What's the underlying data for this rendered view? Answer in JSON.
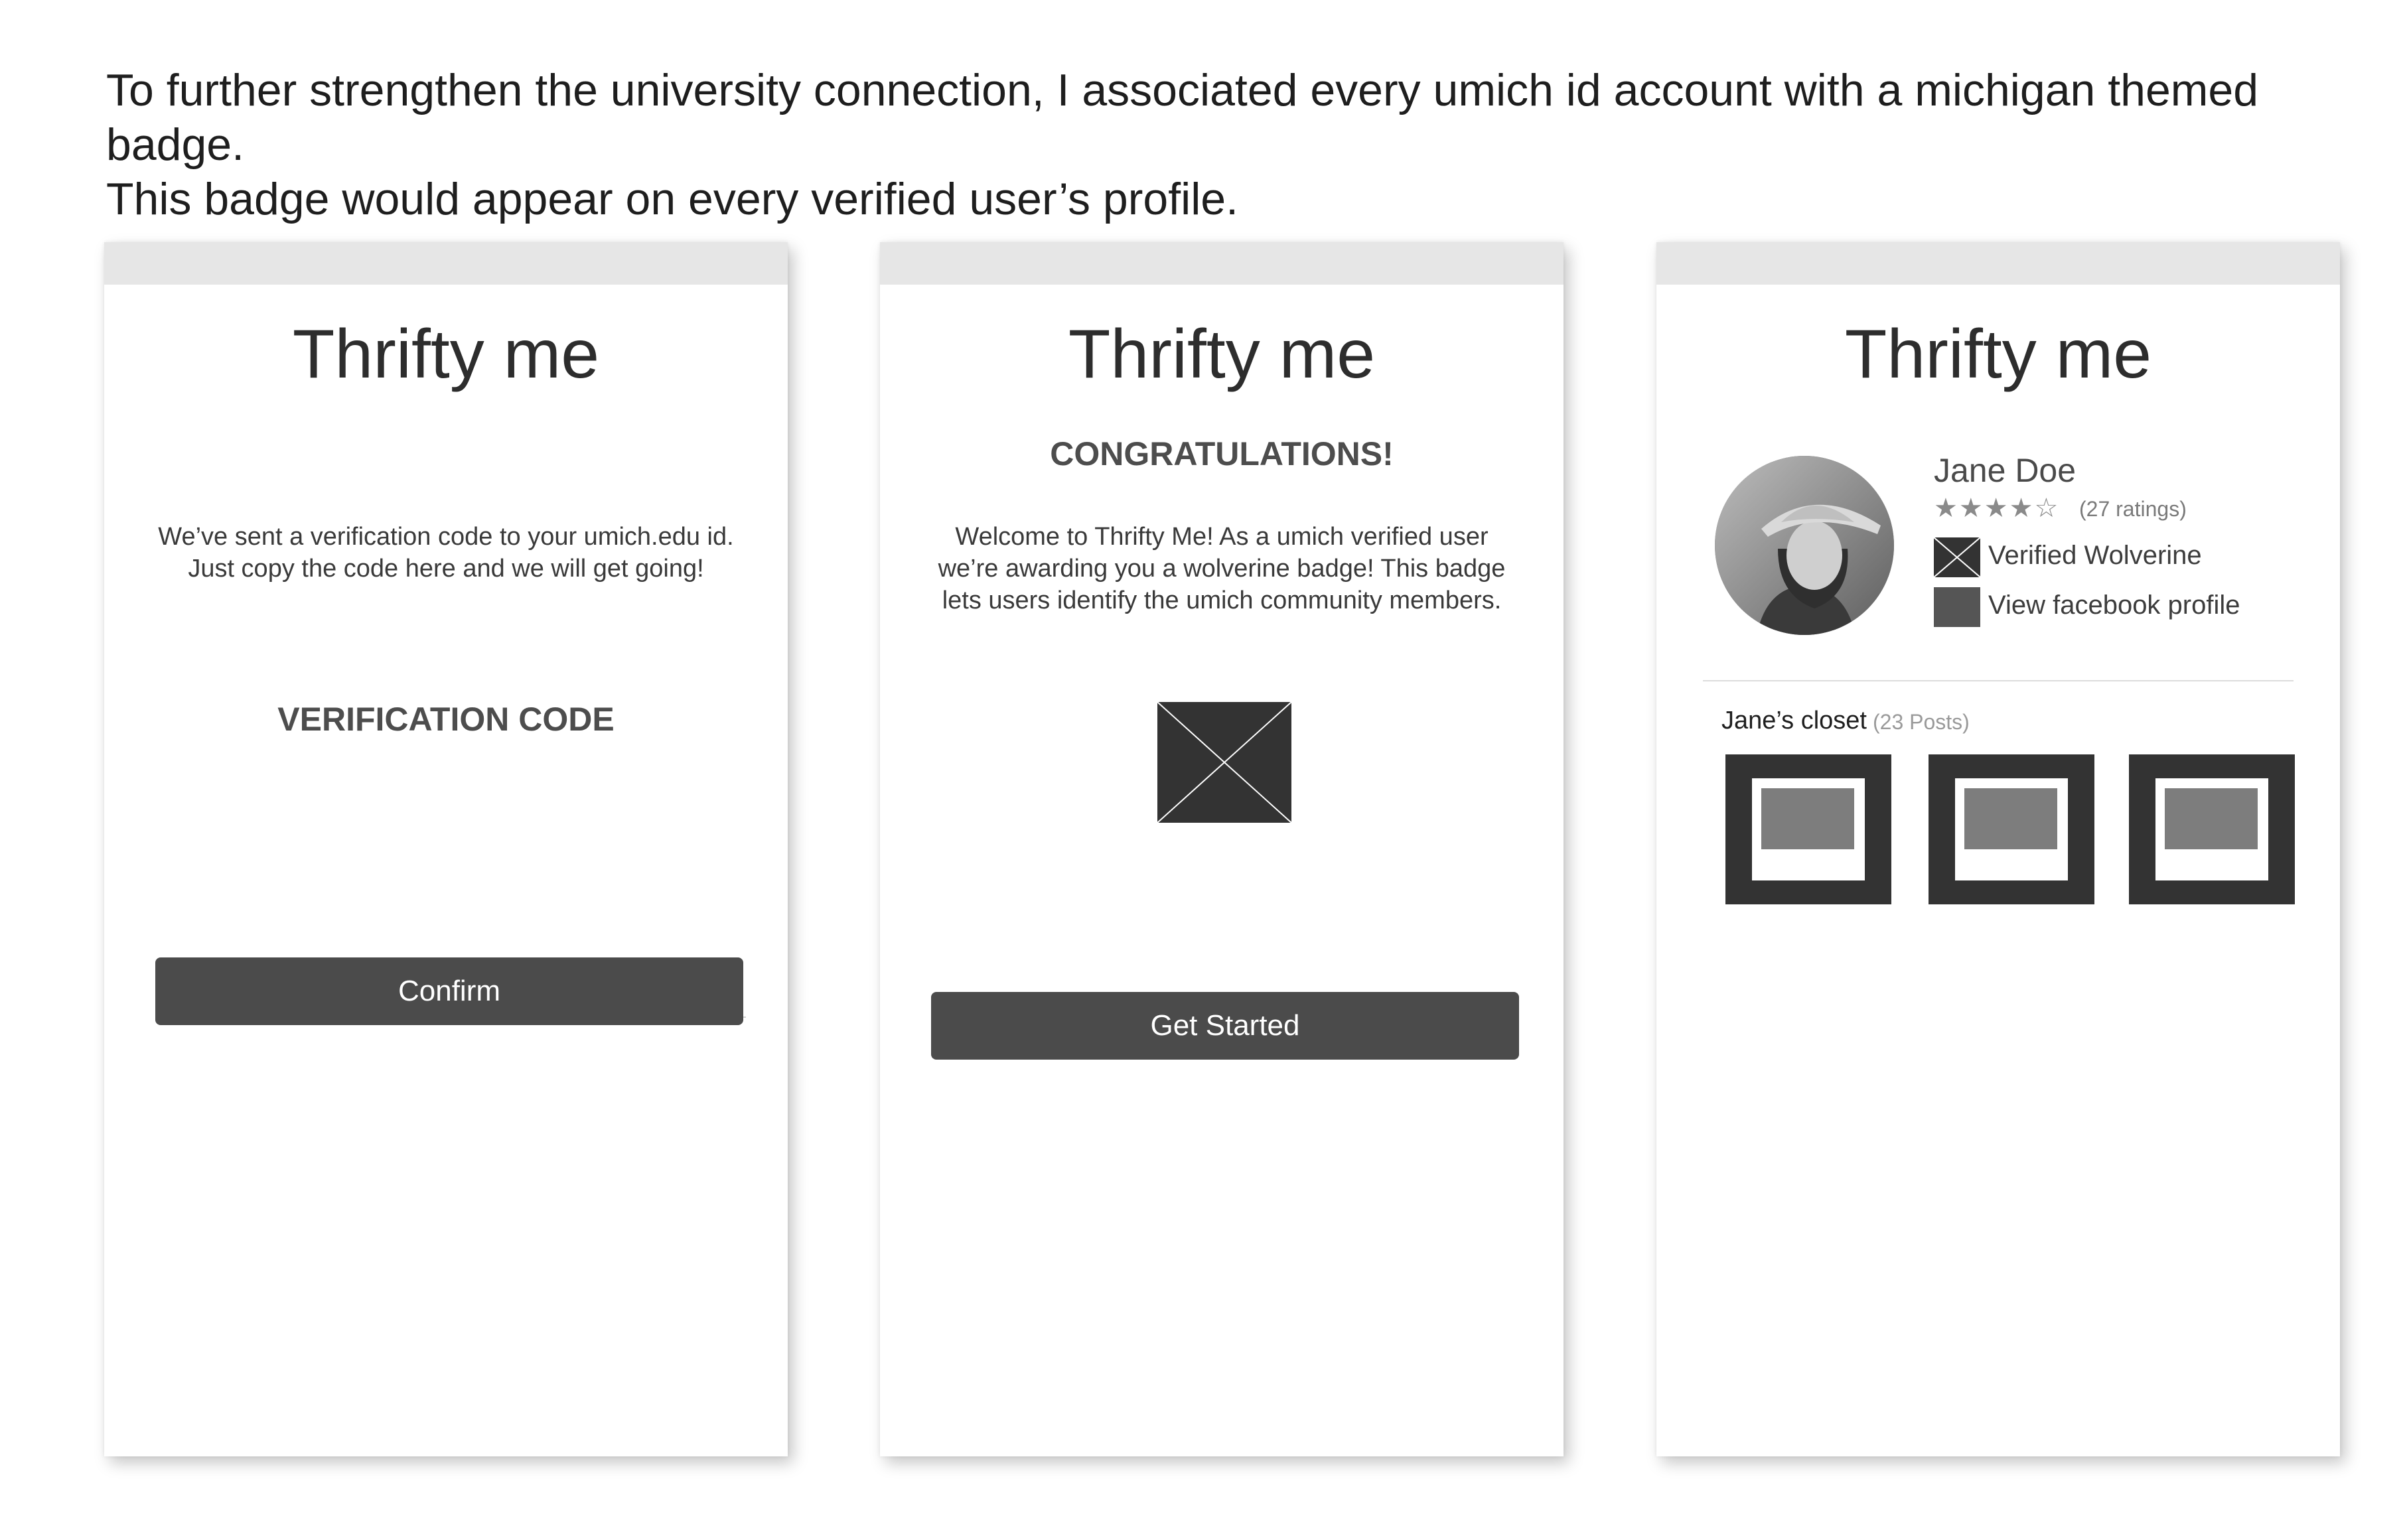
{
  "intro": {
    "line1": "To further strengthen the university connection, I associated every umich id account with a michigan themed badge.",
    "line2": "This badge would appear on every verified user’s profile."
  },
  "screens": [
    {
      "app_title": "Thrifty me",
      "message_line1": "We’ve sent a verification code to your umich.edu id.",
      "message_line2": "Just copy the code here and we will get going!",
      "field_label": "VERIFICATION CODE",
      "code_value": "",
      "button_label": "Confirm"
    },
    {
      "app_title": "Thrifty me",
      "heading": "CONGRATULATIONS!",
      "message_line1": "Welcome to Thrifty Me! As a umich verified user",
      "message_line2": "we’re awarding you a wolverine badge! This badge",
      "message_line3": "lets users identify the umich community members.",
      "badge_icon": "badge-placeholder-icon",
      "button_label": "Get Started"
    },
    {
      "app_title": "Thrifty me",
      "profile": {
        "name": "Jane Doe",
        "rating_stars": 4,
        "rating_stars_glyphs": "★★★★☆",
        "ratings_text": "(27 ratings)",
        "badge_label": "Verified Wolverine",
        "facebook_label": "View facebook profile"
      },
      "closet": {
        "title": "Jane’s closet",
        "count": "(23 Posts)",
        "thumbnails": 3
      }
    }
  ],
  "colors": {
    "topbar": "#e6e6e6",
    "button": "#4b4b4b",
    "thumb_frame": "#333333",
    "thumb_image": "#7d7d7d"
  }
}
